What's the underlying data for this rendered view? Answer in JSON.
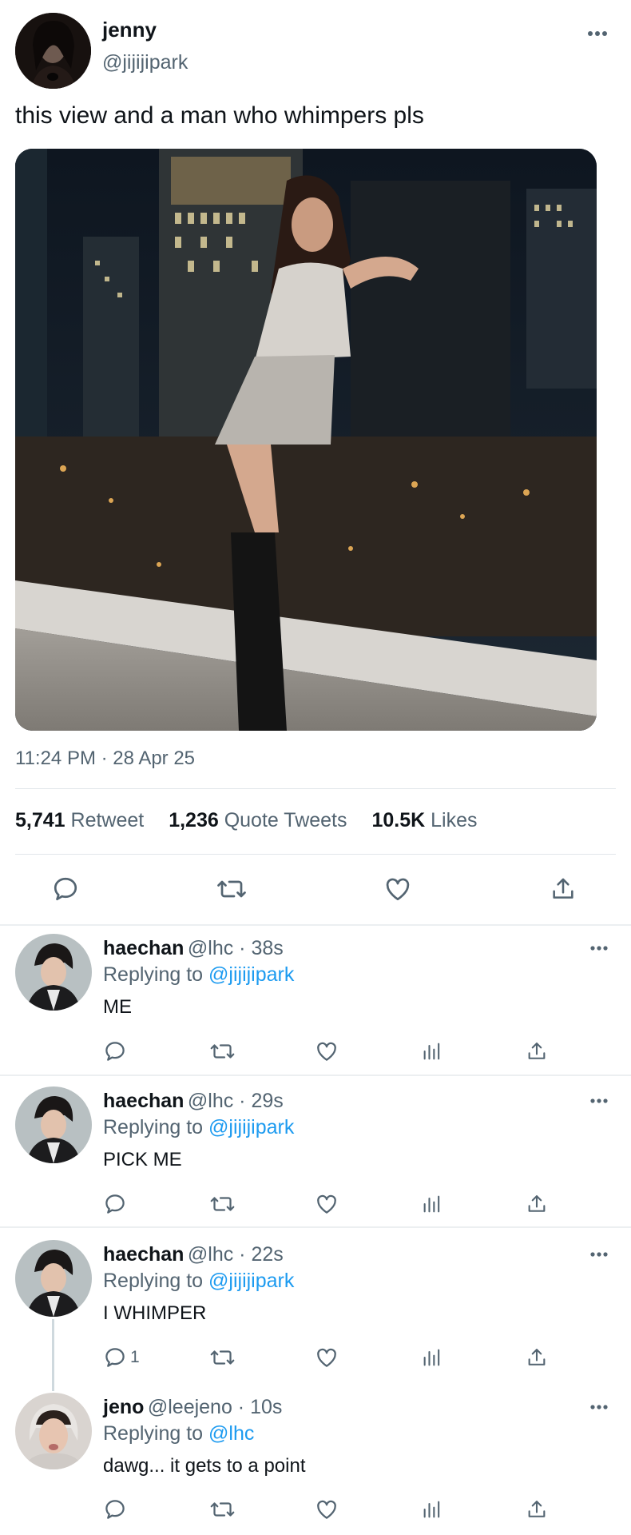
{
  "main_tweet": {
    "name": "jenny",
    "handle": "@jijijipark",
    "text": "this view and a man who whimpers pls",
    "timestamp": "11:24 PM · 28 Apr 25",
    "stats": {
      "retweets_count": "5,741",
      "retweets_label": "Retweet",
      "quotes_count": "1,236",
      "quotes_label": "Quote Tweets",
      "likes_count": "10.5K",
      "likes_label": "Likes"
    },
    "actions": [
      "reply-icon",
      "retweet-icon",
      "like-icon",
      "share-icon"
    ]
  },
  "replies": [
    {
      "name": "haechan",
      "handle_time": "@lhc · 38s",
      "replying_prefix": "Replying to",
      "replying_to": "@jijijipark",
      "text": "ME",
      "reply_count": ""
    },
    {
      "name": "haechan",
      "handle_time": "@lhc · 29s",
      "replying_prefix": "Replying to",
      "replying_to": "@jijijipark",
      "text": "PICK ME",
      "reply_count": ""
    },
    {
      "name": "haechan",
      "handle_time": "@lhc · 22s",
      "replying_prefix": "Replying to",
      "replying_to": "@jijijipark",
      "text": "I WHIMPER",
      "reply_count": "1"
    },
    {
      "name": "jeno",
      "handle_time": "@leejeno · 10s",
      "replying_prefix": "Replying to",
      "replying_to": "@lhc",
      "text": "dawg... it gets to a point",
      "reply_count": ""
    }
  ],
  "colors": {
    "text": "#0f1419",
    "muted": "#536471",
    "link": "#1d9bf0",
    "divider": "#e1e6ea"
  }
}
